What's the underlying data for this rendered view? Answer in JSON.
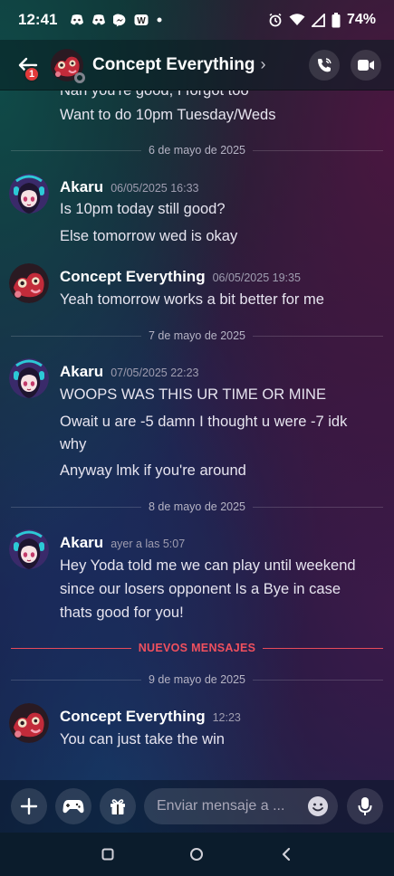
{
  "status_bar": {
    "time": "12:41",
    "battery": "74%",
    "icons": [
      "discord-icon",
      "discord-icon",
      "messenger-icon",
      "webtoon-icon",
      "dot-icon",
      "alarm-icon",
      "wifi-icon",
      "signal-icon",
      "battery-icon"
    ]
  },
  "header": {
    "back_badge": "1",
    "title": "Concept Everything",
    "chevron": "›",
    "actions": [
      "voice-call-icon",
      "video-call-icon"
    ]
  },
  "messages": {
    "partial_top_line": "Nah you're good, I forgot too",
    "g0_line1": "Want to do 10pm Tuesday/Weds",
    "d1": "6 de mayo de 2025",
    "g1": {
      "author": "Akaru",
      "time": "06/05/2025 16:33",
      "lines": [
        "Is 10pm today still good?",
        "Else tomorrow wed is okay"
      ]
    },
    "g2": {
      "author": "Concept Everything",
      "time": "06/05/2025 19:35",
      "lines": [
        "Yeah tomorrow works a bit better for me"
      ]
    },
    "d2": "7 de mayo de 2025",
    "g3": {
      "author": "Akaru",
      "time": "07/05/2025 22:23",
      "lines": [
        "WOOPS WAS THIS UR TIME OR MINE",
        "Owait u are -5 damn I thought u were -7 idk",
        "why",
        "Anyway lmk if you're around"
      ]
    },
    "d3": "8 de mayo de 2025",
    "g4": {
      "author": "Akaru",
      "time": "ayer a las 5:07",
      "lines": [
        "Hey Yoda told me we can play until weekend",
        "since our losers opponent Is a Bye in case",
        "thats good for you!"
      ]
    },
    "new_divider": "NUEVOS MENSAJES",
    "d4": "9 de mayo de 2025",
    "g5": {
      "author": "Concept Everything",
      "time": "12:23",
      "lines": [
        "You can just take the win"
      ]
    }
  },
  "composer": {
    "placeholder": "Enviar mensaje a ...",
    "value": ""
  },
  "colors": {
    "new_messages": "#f0505e",
    "badge": "#e23a3a"
  }
}
